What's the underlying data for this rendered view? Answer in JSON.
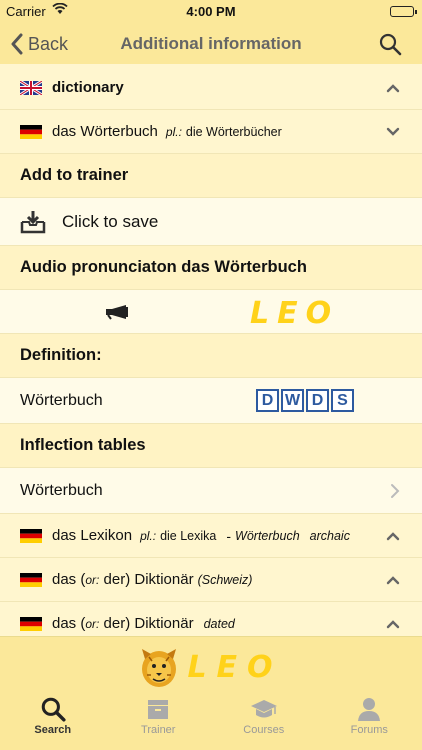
{
  "status": {
    "carrier": "Carrier",
    "time": "4:00 PM"
  },
  "nav": {
    "back_label": "Back",
    "title": "Additional information"
  },
  "entries": {
    "en_term": "dictionary",
    "de_term": "das Wörterbuch",
    "de_pl_label": "pl.:",
    "de_pl_value": "die Wörterbücher"
  },
  "sections": {
    "trainer_header": "Add to trainer",
    "save_label": "Click to save",
    "audio_header": "Audio pronunciaton das Wörterbuch",
    "definition_header": "Definition:",
    "definition_term": "Wörterbuch",
    "dwds_letters": [
      "D",
      "W",
      "D",
      "S"
    ],
    "inflection_header": "Inflection tables",
    "inflection_term": "Wörterbuch"
  },
  "related": [
    {
      "term": "das Lexikon",
      "pl_label": "pl.:",
      "pl_value": "die Lexika",
      "dash": "-",
      "ref": "Wörterbuch",
      "note": "archaic"
    },
    {
      "term_a": "das (",
      "or_label": "or:",
      "term_b": " der) Diktionär",
      "note": "(Schweiz)"
    },
    {
      "term_a": "das (",
      "or_label": "or:",
      "term_b": " der) Diktionär",
      "note": "dated"
    }
  ],
  "brand": {
    "logo_text": "LEO"
  },
  "tabs": [
    {
      "label": "Search",
      "icon": "search-icon"
    },
    {
      "label": "Trainer",
      "icon": "trainer-box-icon"
    },
    {
      "label": "Courses",
      "icon": "graduation-cap-icon"
    },
    {
      "label": "Forums",
      "icon": "person-icon"
    }
  ],
  "colors": {
    "bar": "#fbe89a",
    "background": "#fff6cf",
    "logo": "#ffd21a"
  }
}
